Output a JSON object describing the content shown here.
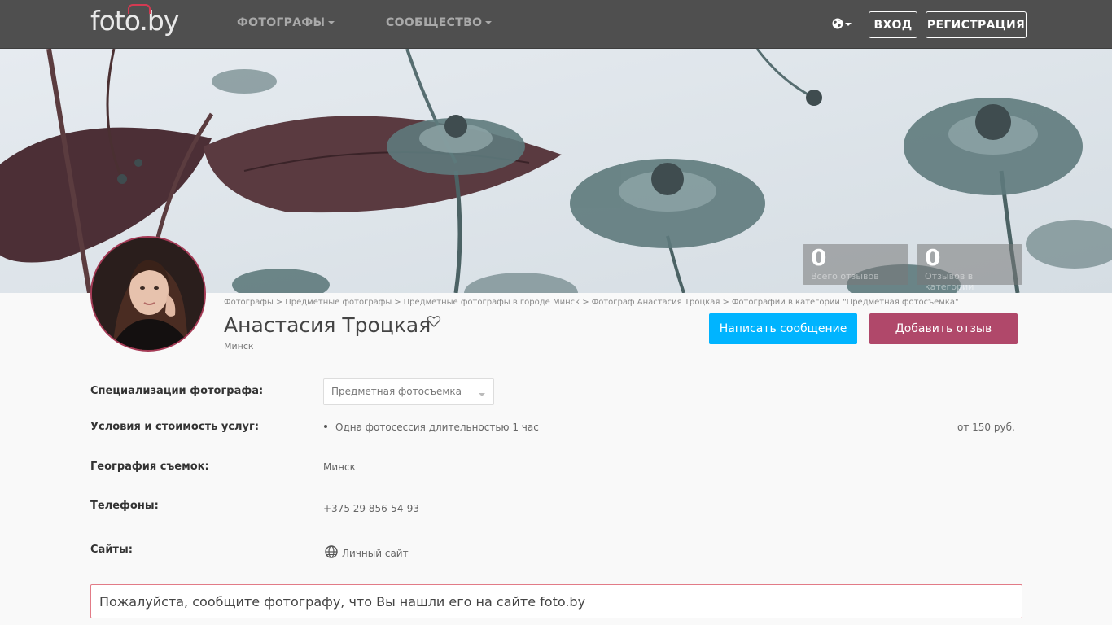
{
  "navbar": {
    "logo": "foto.by",
    "links": [
      "ФОТОГРАФЫ",
      "СООБЩЕСТВО"
    ],
    "login": "ВХОД",
    "register": "РЕГИСТРАЦИЯ",
    "language_icon": "globe-icon"
  },
  "stats": [
    {
      "value": "0",
      "label": "Всего отзывов"
    },
    {
      "value": "0",
      "label": "Отзывов в категории"
    }
  ],
  "breadcrumb": [
    "Фотографы",
    "Предметные фотографы",
    "Предметные фотографы в городе Минск",
    "Фотограф Анастасия Троцкая",
    "Фотографии в категории \"Предметная фотосъемка\""
  ],
  "profile": {
    "name": "Анастасия Троцкая",
    "city": "Минск"
  },
  "actions": {
    "message": "Написать сообщение",
    "review": "Добавить отзыв"
  },
  "details": {
    "specializations_label": "Специализации фотографа:",
    "specialization_value": "Предметная фотосъемка",
    "conditions_label": "Условия и стоимость услуг:",
    "service": "Одна фотосессия длительностью 1 час",
    "price": "от 150 руб.",
    "geography_label": "География съемок:",
    "geography_value": "Минск",
    "phones_label": "Телефоны:",
    "phone": "+375 29 856-54-93",
    "sites_label": "Сайты:",
    "site": "Личный сайт"
  },
  "notice": "Пожалуйста, сообщите фотографу, что Вы нашли его на сайте foto.by",
  "colors": {
    "navbar": "#4f4f4f",
    "message_button": "#00b4ff",
    "review_button": "#b0486a",
    "notice_border": "#e27b87"
  }
}
